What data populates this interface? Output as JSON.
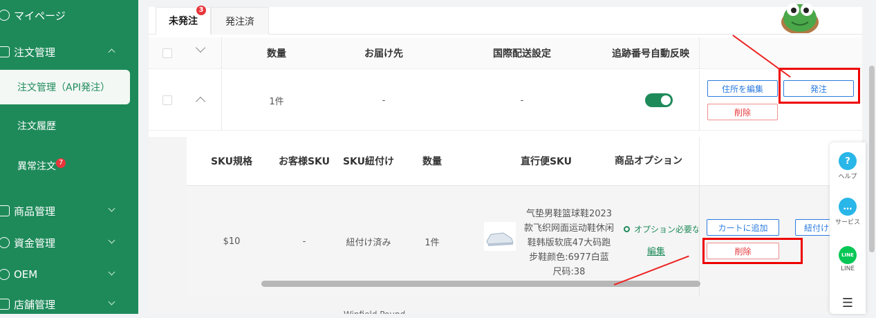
{
  "sidebar": {
    "mypage": "マイページ",
    "order_mgmt": "注文管理",
    "order_api": "注文管理（API発注）",
    "order_history": "注文履歴",
    "abnormal": "異常注文",
    "abnormal_badge": "7",
    "products": "商品管理",
    "funds": "資金管理",
    "oem": "OEM",
    "shops": "店舗管理"
  },
  "tabs": [
    {
      "label": "未発注",
      "badge": "3"
    },
    {
      "label": "発注済"
    }
  ],
  "table": {
    "headers": {
      "qty": "数量",
      "dest": "お届け先",
      "intl": "国際配送設定",
      "tracking": "追跡番号自動反映"
    },
    "row": {
      "qty": "1件",
      "dest": "-",
      "intl": "-"
    },
    "actions": {
      "edit_address": "住所を編集",
      "order": "発注",
      "delete": "削除"
    }
  },
  "sub": {
    "headers": {
      "sku": "SKU規格",
      "cust_sku": "お客様SKU",
      "link": "SKU紐付け",
      "qty": "数量",
      "direct": "直行便SKU",
      "option": "商品オプション"
    },
    "row": {
      "sku": "$10",
      "cust_sku": "-",
      "link": "紐付け済み",
      "qty": "1件",
      "product": "气垫男鞋篮球鞋2023款飞织网面运动鞋休闲鞋韩版软底47大码跑步鞋颜色:6977白蓝 尺码:38",
      "option_required": "オプション必要な",
      "edit": "編集"
    },
    "actions": {
      "cart": "カートに追加",
      "link_change": "紐付け変",
      "delete": "削除"
    },
    "next_row_partial": "Winfield Pound"
  },
  "support": {
    "help": "ヘルプ",
    "service": "サービス",
    "line_badge": "LINE",
    "line": "LINE"
  },
  "colors": {
    "sidebar": "#1e8a5a",
    "accent_blue": "#2b7be0",
    "danger": "#e8363b",
    "highlight": "#e00000"
  }
}
